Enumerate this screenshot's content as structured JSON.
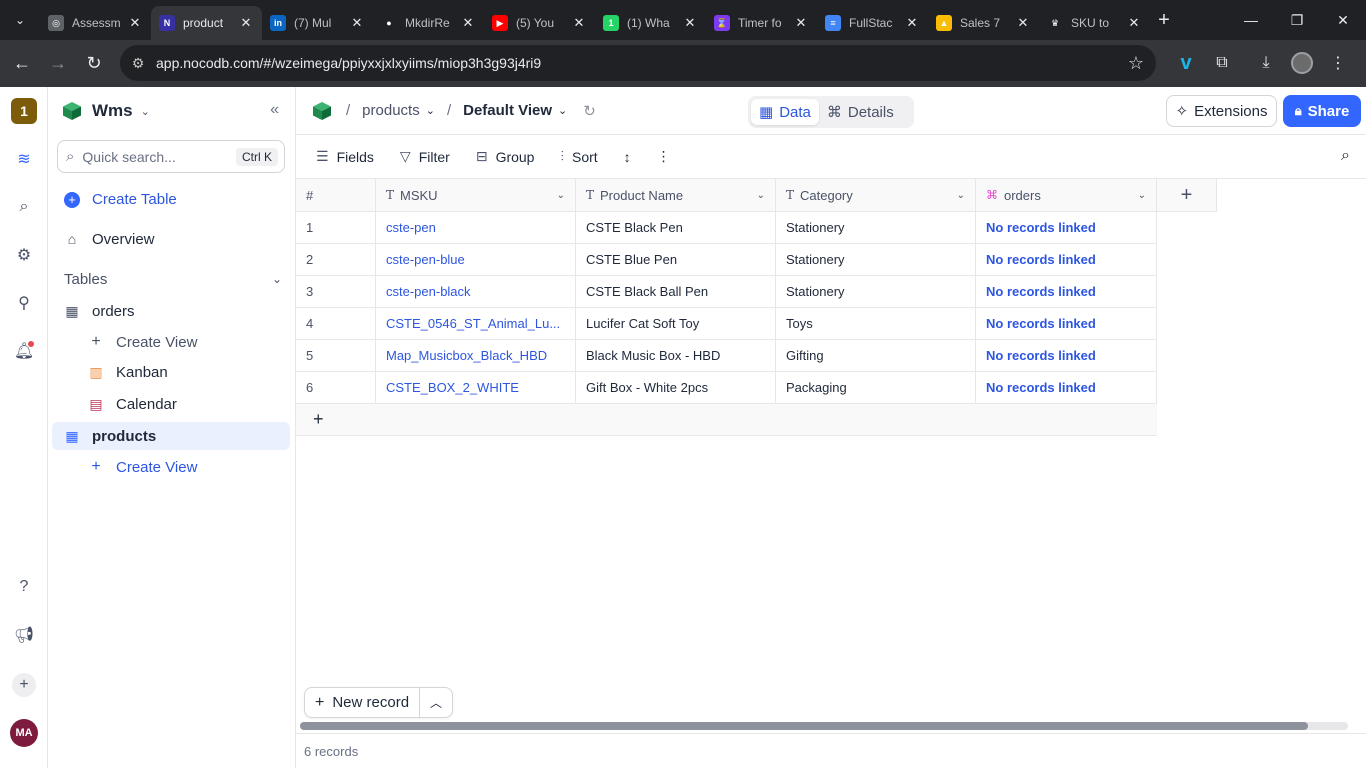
{
  "browser": {
    "tabs": [
      {
        "title": "Assessm",
        "favicon": "chatgpt-icon",
        "color": "#5f6368",
        "glyph": "◎",
        "active": false
      },
      {
        "title": "product",
        "favicon": "nocodb-icon",
        "color": "#3730a3",
        "glyph": "N",
        "active": true
      },
      {
        "title": "(7) Mul",
        "favicon": "linkedin-icon",
        "color": "#0a66c2",
        "glyph": "in",
        "active": false
      },
      {
        "title": "MkdirRe",
        "favicon": "github-icon",
        "color": "#202124",
        "glyph": "●",
        "active": false
      },
      {
        "title": "(5) You",
        "favicon": "youtube-icon",
        "color": "#ff0000",
        "glyph": "▶",
        "active": false
      },
      {
        "title": "(1) Wha",
        "favicon": "whatsapp-icon",
        "color": "#25d366",
        "glyph": "1",
        "active": false
      },
      {
        "title": "Timer fo",
        "favicon": "timer-icon",
        "color": "#7e3af2",
        "glyph": "⌛",
        "active": false
      },
      {
        "title": "FullStac",
        "favicon": "docs-icon",
        "color": "#4285f4",
        "glyph": "≡",
        "active": false
      },
      {
        "title": "Sales 7",
        "favicon": "drive-icon",
        "color": "#fbbc04",
        "glyph": "▲",
        "active": false
      },
      {
        "title": "SKU to",
        "favicon": "crown-icon",
        "color": "#202124",
        "glyph": "♛",
        "active": false
      }
    ],
    "url": "app.nocodb.com/#/wzeimega/ppiyxxjxlxyiims/miop3h3g93j4ri9"
  },
  "rail": {
    "workspace_badge": "1",
    "avatar_initials": "MA"
  },
  "sidebar": {
    "base_name": "Wms",
    "search_placeholder": "Quick search...",
    "search_shortcut": "Ctrl K",
    "create_table": "Create Table",
    "overview": "Overview",
    "tables_header": "Tables",
    "items": [
      {
        "label": "orders"
      },
      {
        "label": "Create View"
      },
      {
        "label": "Kanban"
      },
      {
        "label": "Calendar"
      },
      {
        "label": "products"
      },
      {
        "label": "Create View"
      }
    ]
  },
  "topbar": {
    "table_name": "products",
    "view_name": "Default View",
    "tab_data": "Data",
    "tab_details": "Details",
    "extensions": "Extensions",
    "share": "Share"
  },
  "toolbar": {
    "fields": "Fields",
    "filter": "Filter",
    "group": "Group",
    "sort": "Sort"
  },
  "table": {
    "columns": [
      "#",
      "MSKU",
      "Product Name",
      "Category",
      "orders"
    ],
    "rows": [
      {
        "num": "1",
        "msku": "cste-pen",
        "product": "CSTE Black Pen",
        "category": "Stationery",
        "orders": "No records linked"
      },
      {
        "num": "2",
        "msku": "cste-pen-blue",
        "product": "CSTE Blue Pen",
        "category": "Stationery",
        "orders": "No records linked"
      },
      {
        "num": "3",
        "msku": "cste-pen-black",
        "product": "CSTE Black Ball Pen",
        "category": "Stationery",
        "orders": "No records linked"
      },
      {
        "num": "4",
        "msku": "CSTE_0546_ST_Animal_Lu...",
        "product": "Lucifer Cat Soft Toy",
        "category": "Toys",
        "orders": "No records linked"
      },
      {
        "num": "5",
        "msku": "Map_Musicbox_Black_HBD",
        "product": "Black Music Box - HBD",
        "category": "Gifting",
        "orders": "No records linked"
      },
      {
        "num": "6",
        "msku": "CSTE_BOX_2_WHITE",
        "product": "Gift Box - White 2pcs",
        "category": "Packaging",
        "orders": "No records linked"
      }
    ]
  },
  "footer": {
    "new_record": "New record",
    "record_count": "6 records"
  }
}
